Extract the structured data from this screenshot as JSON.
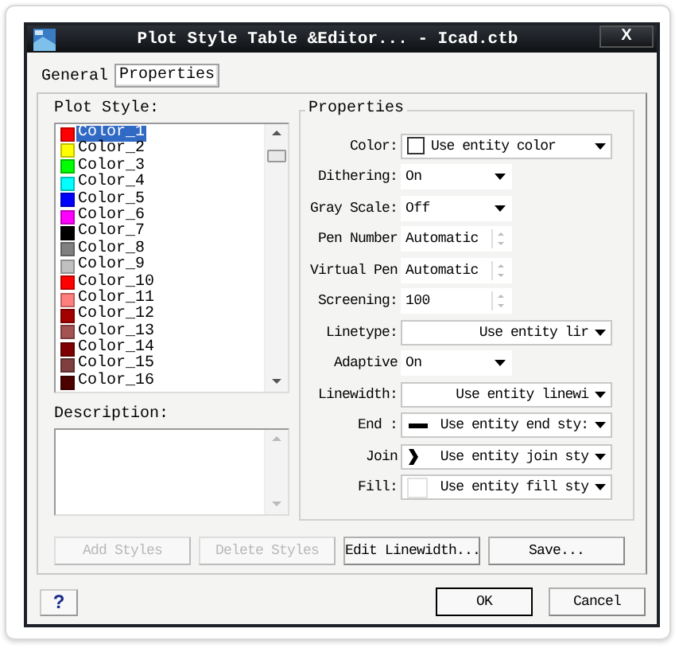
{
  "window": {
    "title": "Plot Style Table &Editor... - Icad.ctb",
    "close": "X"
  },
  "tabs": [
    {
      "label": "General",
      "selected": false
    },
    {
      "label": "Properties",
      "selected": true
    }
  ],
  "plot_style": {
    "label": "Plot Style:",
    "items": [
      {
        "name": "Color_1",
        "color": "#ff0000",
        "selected": true
      },
      {
        "name": "Color_2",
        "color": "#ffff00",
        "selected": false
      },
      {
        "name": "Color_3",
        "color": "#00ff00",
        "selected": false
      },
      {
        "name": "Color_4",
        "color": "#00ffff",
        "selected": false
      },
      {
        "name": "Color_5",
        "color": "#0000ff",
        "selected": false
      },
      {
        "name": "Color_6",
        "color": "#ff00ff",
        "selected": false
      },
      {
        "name": "Color_7",
        "color": "#000000",
        "selected": false
      },
      {
        "name": "Color_8",
        "color": "#808080",
        "selected": false
      },
      {
        "name": "Color_9",
        "color": "#c0c0c0",
        "selected": false
      },
      {
        "name": "Color_10",
        "color": "#ff0000",
        "selected": false
      },
      {
        "name": "Color_11",
        "color": "#ff7f7f",
        "selected": false
      },
      {
        "name": "Color_12",
        "color": "#a50000",
        "selected": false
      },
      {
        "name": "Color_13",
        "color": "#a55252",
        "selected": false
      },
      {
        "name": "Color_14",
        "color": "#7f0000",
        "selected": false
      },
      {
        "name": "Color_15",
        "color": "#7f3f3f",
        "selected": false
      },
      {
        "name": "Color_16",
        "color": "#4c0000",
        "selected": false
      }
    ]
  },
  "description": {
    "label": "Description:"
  },
  "properties": {
    "title": "Properties",
    "rows": [
      {
        "label": "Color:",
        "kind": "color-select",
        "value": "Use entity color"
      },
      {
        "label": "Dithering:",
        "kind": "select",
        "value": "On"
      },
      {
        "label": "Gray Scale:",
        "kind": "select",
        "value": "Off"
      },
      {
        "label": "Pen Number",
        "kind": "spin",
        "value": "Automatic"
      },
      {
        "label": "Virtual Pen",
        "kind": "spin",
        "value": "Automatic"
      },
      {
        "label": "Screening:",
        "kind": "spin",
        "value": "100"
      },
      {
        "label": "Linetype:",
        "kind": "wide-select",
        "value": "Use entity lir"
      },
      {
        "label": "Adaptive",
        "kind": "select",
        "value": "On"
      },
      {
        "label": "Linewidth:",
        "kind": "wide-select",
        "value": "Use entity linewi"
      },
      {
        "label": "End :",
        "kind": "line-select",
        "value": "Use entity end sty:"
      },
      {
        "label": "Join",
        "kind": "join-select",
        "value": "Use entity join sty"
      },
      {
        "label": "Fill:",
        "kind": "fill-select",
        "value": "Use entity fill sty"
      }
    ]
  },
  "actions": [
    {
      "label": "Add Styles",
      "disabled": true
    },
    {
      "label": "Delete Styles",
      "disabled": true
    },
    {
      "label": "Edit Linewidth...",
      "disabled": false
    },
    {
      "label": "Save...",
      "disabled": false
    }
  ],
  "footer": {
    "help": "?",
    "buttons": [
      {
        "label": "OK",
        "default": true
      },
      {
        "label": "Cancel",
        "default": false
      }
    ]
  }
}
